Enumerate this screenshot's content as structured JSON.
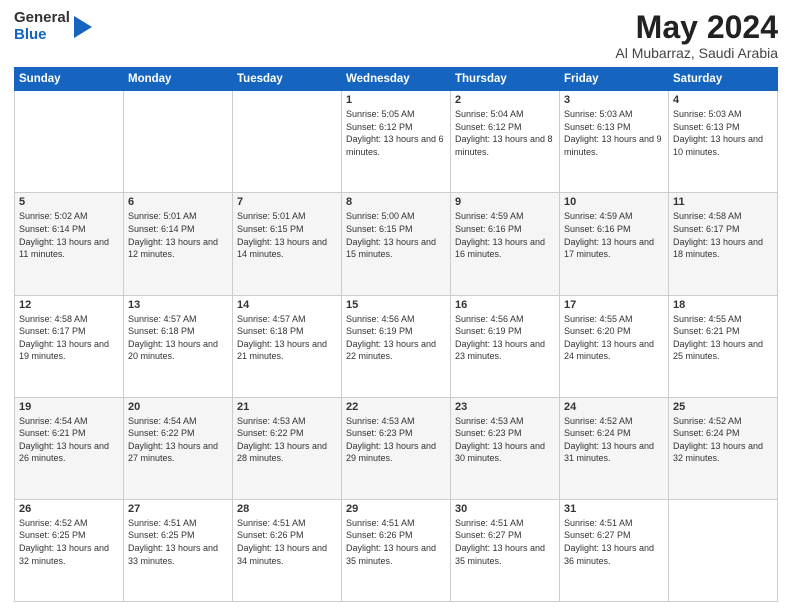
{
  "header": {
    "logo_general": "General",
    "logo_blue": "Blue",
    "main_title": "May 2024",
    "sub_title": "Al Mubarraz, Saudi Arabia"
  },
  "weekdays": [
    "Sunday",
    "Monday",
    "Tuesday",
    "Wednesday",
    "Thursday",
    "Friday",
    "Saturday"
  ],
  "weeks": [
    [
      {
        "day": "",
        "info": ""
      },
      {
        "day": "",
        "info": ""
      },
      {
        "day": "",
        "info": ""
      },
      {
        "day": "1",
        "info": "Sunrise: 5:05 AM\nSunset: 6:12 PM\nDaylight: 13 hours and 6 minutes."
      },
      {
        "day": "2",
        "info": "Sunrise: 5:04 AM\nSunset: 6:12 PM\nDaylight: 13 hours and 8 minutes."
      },
      {
        "day": "3",
        "info": "Sunrise: 5:03 AM\nSunset: 6:13 PM\nDaylight: 13 hours and 9 minutes."
      },
      {
        "day": "4",
        "info": "Sunrise: 5:03 AM\nSunset: 6:13 PM\nDaylight: 13 hours and 10 minutes."
      }
    ],
    [
      {
        "day": "5",
        "info": "Sunrise: 5:02 AM\nSunset: 6:14 PM\nDaylight: 13 hours and 11 minutes."
      },
      {
        "day": "6",
        "info": "Sunrise: 5:01 AM\nSunset: 6:14 PM\nDaylight: 13 hours and 12 minutes."
      },
      {
        "day": "7",
        "info": "Sunrise: 5:01 AM\nSunset: 6:15 PM\nDaylight: 13 hours and 14 minutes."
      },
      {
        "day": "8",
        "info": "Sunrise: 5:00 AM\nSunset: 6:15 PM\nDaylight: 13 hours and 15 minutes."
      },
      {
        "day": "9",
        "info": "Sunrise: 4:59 AM\nSunset: 6:16 PM\nDaylight: 13 hours and 16 minutes."
      },
      {
        "day": "10",
        "info": "Sunrise: 4:59 AM\nSunset: 6:16 PM\nDaylight: 13 hours and 17 minutes."
      },
      {
        "day": "11",
        "info": "Sunrise: 4:58 AM\nSunset: 6:17 PM\nDaylight: 13 hours and 18 minutes."
      }
    ],
    [
      {
        "day": "12",
        "info": "Sunrise: 4:58 AM\nSunset: 6:17 PM\nDaylight: 13 hours and 19 minutes."
      },
      {
        "day": "13",
        "info": "Sunrise: 4:57 AM\nSunset: 6:18 PM\nDaylight: 13 hours and 20 minutes."
      },
      {
        "day": "14",
        "info": "Sunrise: 4:57 AM\nSunset: 6:18 PM\nDaylight: 13 hours and 21 minutes."
      },
      {
        "day": "15",
        "info": "Sunrise: 4:56 AM\nSunset: 6:19 PM\nDaylight: 13 hours and 22 minutes."
      },
      {
        "day": "16",
        "info": "Sunrise: 4:56 AM\nSunset: 6:19 PM\nDaylight: 13 hours and 23 minutes."
      },
      {
        "day": "17",
        "info": "Sunrise: 4:55 AM\nSunset: 6:20 PM\nDaylight: 13 hours and 24 minutes."
      },
      {
        "day": "18",
        "info": "Sunrise: 4:55 AM\nSunset: 6:21 PM\nDaylight: 13 hours and 25 minutes."
      }
    ],
    [
      {
        "day": "19",
        "info": "Sunrise: 4:54 AM\nSunset: 6:21 PM\nDaylight: 13 hours and 26 minutes."
      },
      {
        "day": "20",
        "info": "Sunrise: 4:54 AM\nSunset: 6:22 PM\nDaylight: 13 hours and 27 minutes."
      },
      {
        "day": "21",
        "info": "Sunrise: 4:53 AM\nSunset: 6:22 PM\nDaylight: 13 hours and 28 minutes."
      },
      {
        "day": "22",
        "info": "Sunrise: 4:53 AM\nSunset: 6:23 PM\nDaylight: 13 hours and 29 minutes."
      },
      {
        "day": "23",
        "info": "Sunrise: 4:53 AM\nSunset: 6:23 PM\nDaylight: 13 hours and 30 minutes."
      },
      {
        "day": "24",
        "info": "Sunrise: 4:52 AM\nSunset: 6:24 PM\nDaylight: 13 hours and 31 minutes."
      },
      {
        "day": "25",
        "info": "Sunrise: 4:52 AM\nSunset: 6:24 PM\nDaylight: 13 hours and 32 minutes."
      }
    ],
    [
      {
        "day": "26",
        "info": "Sunrise: 4:52 AM\nSunset: 6:25 PM\nDaylight: 13 hours and 32 minutes."
      },
      {
        "day": "27",
        "info": "Sunrise: 4:51 AM\nSunset: 6:25 PM\nDaylight: 13 hours and 33 minutes."
      },
      {
        "day": "28",
        "info": "Sunrise: 4:51 AM\nSunset: 6:26 PM\nDaylight: 13 hours and 34 minutes."
      },
      {
        "day": "29",
        "info": "Sunrise: 4:51 AM\nSunset: 6:26 PM\nDaylight: 13 hours and 35 minutes."
      },
      {
        "day": "30",
        "info": "Sunrise: 4:51 AM\nSunset: 6:27 PM\nDaylight: 13 hours and 35 minutes."
      },
      {
        "day": "31",
        "info": "Sunrise: 4:51 AM\nSunset: 6:27 PM\nDaylight: 13 hours and 36 minutes."
      },
      {
        "day": "",
        "info": ""
      }
    ]
  ]
}
